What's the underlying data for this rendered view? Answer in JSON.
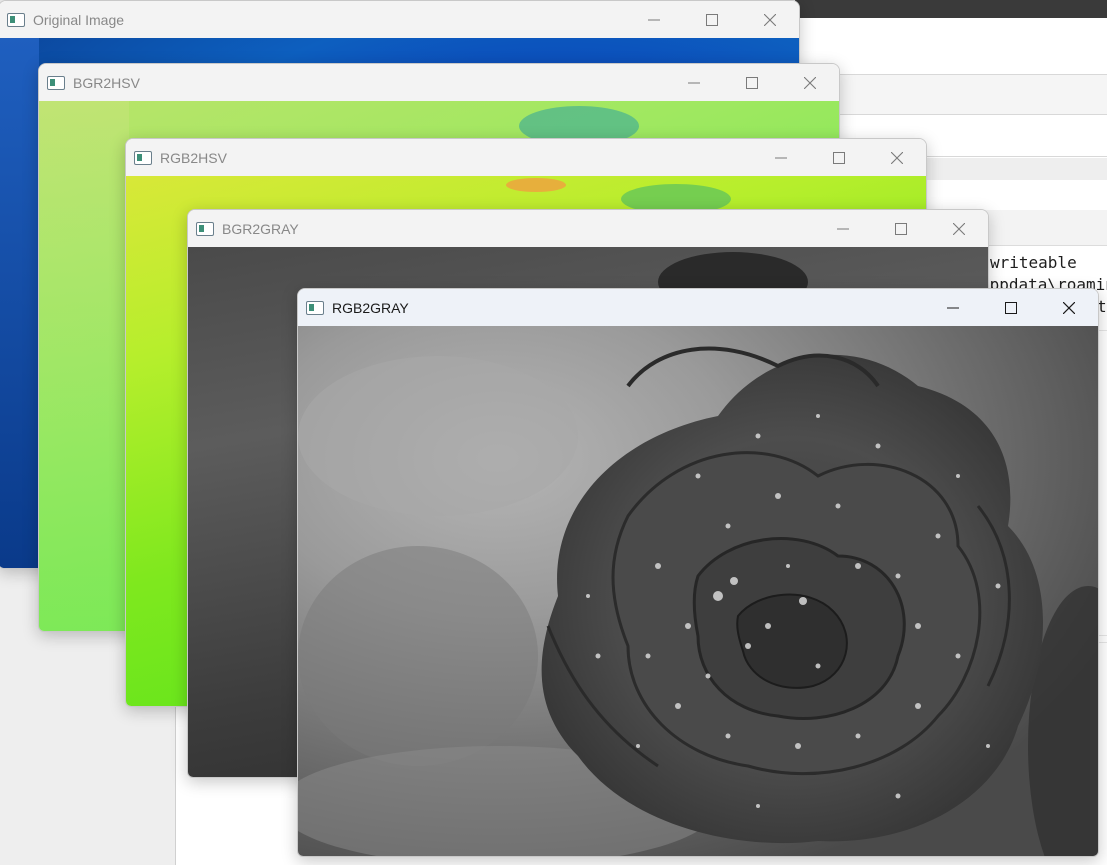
{
  "windows": {
    "original": {
      "title": "Original Image"
    },
    "bgr2hsv": {
      "title": "BGR2HSV"
    },
    "rgb2hsv": {
      "title": "RGB2HSV"
    },
    "bgr2gray": {
      "title": "BGR2GRAY"
    },
    "rgb2gray": {
      "title": "RGB2GRAY"
    }
  },
  "background_terminal": {
    "lines": [
      "writeable",
      "appdata\\roaming",
      "t"
    ]
  },
  "icons": {
    "minimize": "minimize-icon",
    "maximize": "maximize-icon",
    "close": "close-icon",
    "app": "opencv-window-icon"
  }
}
